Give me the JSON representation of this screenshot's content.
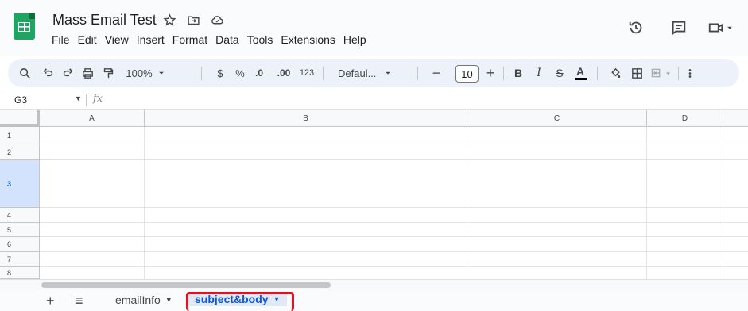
{
  "header": {
    "doc_title": "Mass Email Test",
    "title_icons": [
      "star-icon",
      "folder-move-icon",
      "cloud-status-icon"
    ],
    "menu": [
      "File",
      "Edit",
      "View",
      "Insert",
      "Format",
      "Data",
      "Tools",
      "Extensions",
      "Help"
    ],
    "right_icons": [
      "version-history-icon",
      "comments-icon",
      "meet-icon"
    ]
  },
  "toolbar": {
    "zoom": "100%",
    "currency": "$",
    "percent": "%",
    "dec_decrease": ".0",
    "dec_increase": ".00",
    "more_formats": "123",
    "font": "Defaul...",
    "font_size": "10",
    "minus": "−",
    "plus": "+",
    "bold": "B",
    "italic": "I",
    "strike": "S",
    "text_color": "A",
    "text_color_value": "#000000"
  },
  "formula_bar": {
    "name_box": "G3",
    "fx_label": "fx"
  },
  "grid": {
    "columns": [
      "A",
      "B",
      "C",
      "D"
    ],
    "rows": [
      "1",
      "2",
      "3",
      "4",
      "5",
      "6",
      "7",
      "8"
    ],
    "selected_row": "3"
  },
  "sheets": {
    "add_label": "+",
    "menu_label": "≡",
    "tabs": [
      {
        "name": "emailInfo",
        "active": false
      },
      {
        "name": "subject&body",
        "active": true
      }
    ]
  },
  "colors": {
    "accent": "#0b57d0",
    "sheets_green": "#1fa463",
    "highlight_red": "#e8101e",
    "toolbar_bg": "#edf2fa"
  }
}
